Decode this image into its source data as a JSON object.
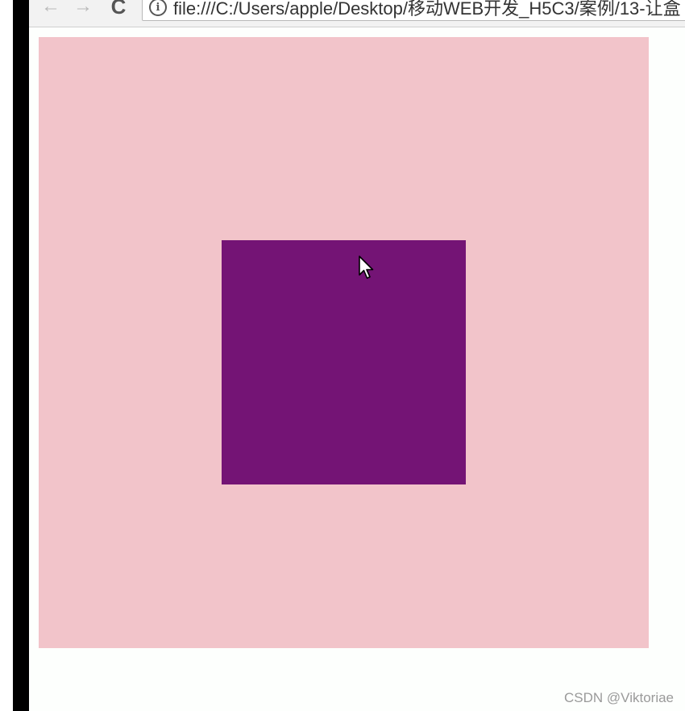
{
  "browser": {
    "nav": {
      "back_icon": "←",
      "forward_icon": "→",
      "reload_icon": "C"
    },
    "address_bar": {
      "info_icon": "i",
      "url": "file:///C:/Users/apple/Desktop/移动WEB开发_H5C3/案例/13-让盒"
    }
  },
  "page": {
    "outer_box_color": "#f2c4ca",
    "inner_box_color": "#741475"
  },
  "watermark": {
    "text": "CSDN @Viktoriae"
  }
}
